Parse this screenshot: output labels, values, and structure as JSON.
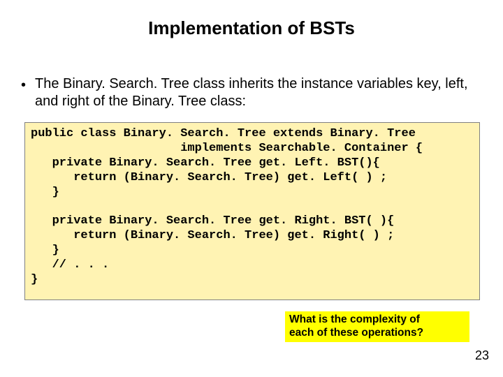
{
  "title": "Implementation of BSTs",
  "bullet": {
    "text": "The Binary. Search. Tree class inherits the instance variables key, left, and right of the Binary. Tree class:"
  },
  "code": {
    "line1": "public class Binary. Search. Tree extends Binary. Tree",
    "line2": "                     implements Searchable. Container {",
    "line3": "   private Binary. Search. Tree get. Left. BST(){",
    "line4": "      return (Binary. Search. Tree) get. Left( ) ;",
    "line5": "   }",
    "line6": "",
    "line7": "   private Binary. Search. Tree get. Right. BST( ){",
    "line8": "      return (Binary. Search. Tree) get. Right( ) ;",
    "line9": "   }",
    "line10": "   // . . .",
    "line11": "}"
  },
  "callout": {
    "line1": "What is the complexity of",
    "line2": " each of these operations?"
  },
  "pageNumber": "23"
}
